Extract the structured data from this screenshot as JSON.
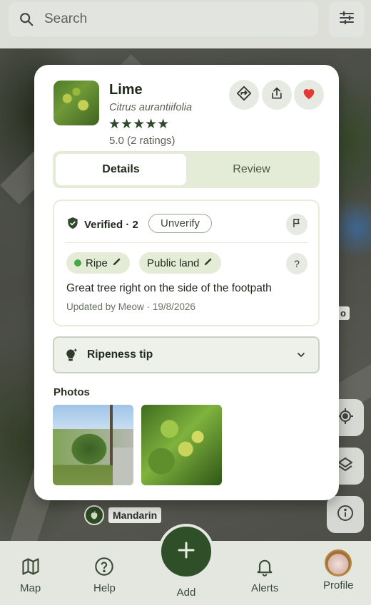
{
  "search": {
    "placeholder": "Search"
  },
  "map": {
    "markers": [
      {
        "label": "Mandarin"
      },
      {
        "label": "o"
      }
    ]
  },
  "card": {
    "plant": {
      "name": "Lime",
      "scientific_name": "Citrus aurantiifolia",
      "stars": "★★★★★",
      "rating_text": "5.0 (2 ratings)"
    },
    "tabs": [
      {
        "label": "Details",
        "active": true
      },
      {
        "label": "Review",
        "active": false
      }
    ],
    "verification": {
      "status": "Verified · 2",
      "unverify_label": "Unverify"
    },
    "chips": [
      {
        "label": "Ripe"
      },
      {
        "label": "Public land"
      }
    ],
    "help_label": "?",
    "description": "Great tree right on the side of the footpath",
    "updated": "Updated by Meow · 19/8/2026",
    "tip": {
      "label": "Ripeness tip"
    },
    "photos": {
      "heading": "Photos",
      "count": 2
    }
  },
  "nav": {
    "items": [
      {
        "label": "Map"
      },
      {
        "label": "Help"
      },
      {
        "label": "Add"
      },
      {
        "label": "Alerts"
      },
      {
        "label": "Profile"
      }
    ]
  },
  "colors": {
    "accent_dark_green": "#2e4f28",
    "tab_bg": "#e4ecd8",
    "favorite_red": "#e53935",
    "ripe_dot": "#44aa44"
  }
}
